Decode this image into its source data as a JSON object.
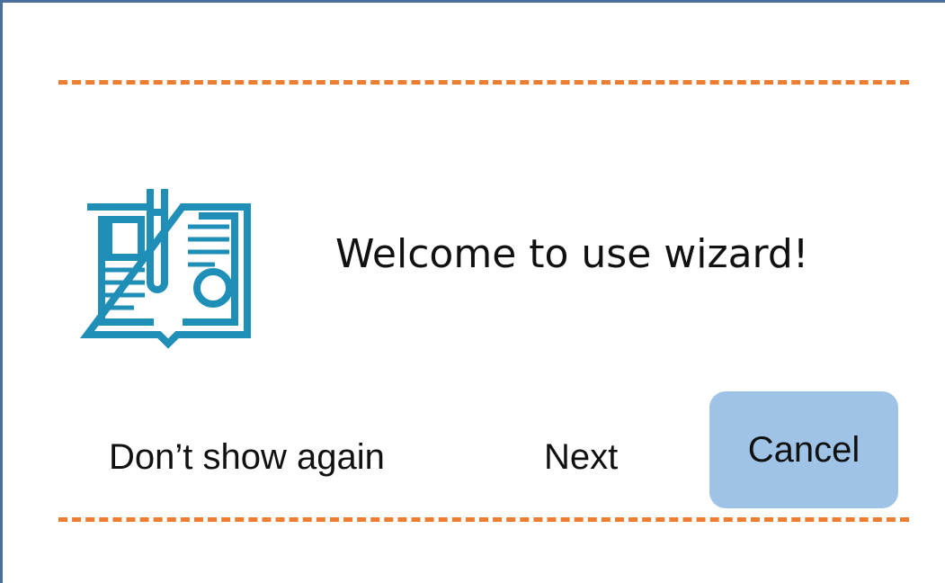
{
  "dialog": {
    "welcome_text": "Welcome to use wizard!",
    "icon": "manual-wrench-gear-icon"
  },
  "buttons": {
    "dont_show_again": "Don’t show again",
    "next": "Next",
    "cancel": "Cancel"
  },
  "colors": {
    "frame_border": "#4a6f9a",
    "divider": "#ed7d31",
    "icon": "#1f8fb8",
    "cancel_bg": "#9ec3e6"
  }
}
